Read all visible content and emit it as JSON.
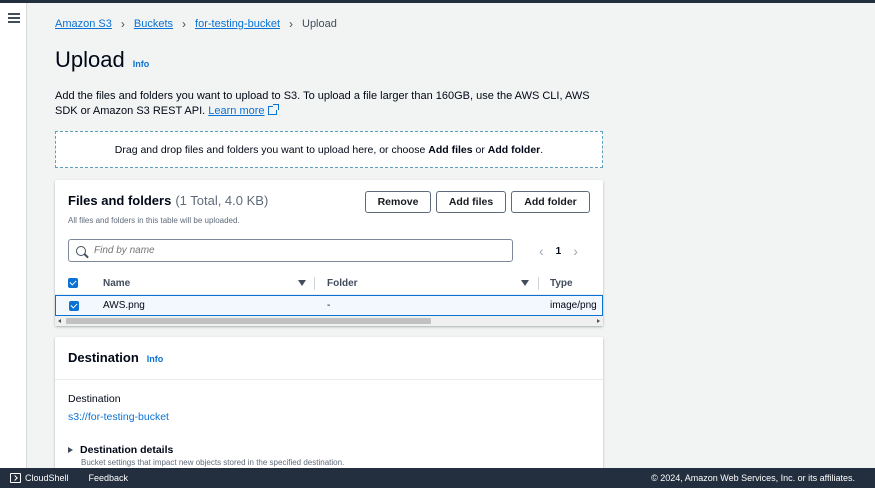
{
  "nav": {
    "menu_icon": "hamburger-icon"
  },
  "breadcrumb": {
    "items": [
      "Amazon S3",
      "Buckets",
      "for-testing-bucket"
    ],
    "current": "Upload",
    "separator_icon": "chevron-right-icon"
  },
  "page": {
    "title": "Upload",
    "info_label": "Info",
    "description": "Add the files and folders you want to upload to S3. To upload a file larger than 160GB, use the AWS CLI, AWS SDK or Amazon S3 REST API.",
    "learn_more": "Learn more",
    "learn_more_icon": "external-link-icon"
  },
  "dropzone": {
    "text_before": "Drag and drop files and folders you want to upload here, or choose ",
    "add_files": "Add files",
    "or": " or ",
    "add_folder": "Add folder",
    "period": "."
  },
  "files_panel": {
    "title": "Files and folders",
    "count": "(1 Total, 4.0 KB)",
    "subtitle": "All files and folders in this table will be uploaded.",
    "buttons": {
      "remove": "Remove",
      "add_files": "Add files",
      "add_folder": "Add folder"
    },
    "search": {
      "placeholder": "Find by name",
      "icon": "search-icon"
    },
    "pagination": {
      "prev": "‹",
      "page": "1",
      "next": "›"
    },
    "columns": [
      "Name",
      "Folder",
      "Type"
    ],
    "rows": [
      {
        "name": "AWS.png",
        "folder": "-",
        "type": "image/png",
        "selected": true
      }
    ]
  },
  "destination_panel": {
    "title": "Destination",
    "info_label": "Info",
    "label": "Destination",
    "value": "s3://for-testing-bucket",
    "details_label": "Destination details",
    "details_sub": "Bucket settings that impact new objects stored in the specified destination."
  },
  "footer": {
    "cloudshell": "CloudShell",
    "feedback": "Feedback",
    "copyright": "© 2024, Amazon Web Services, Inc. or its affiliates."
  },
  "colors": {
    "link": "#0972d3",
    "topbar": "#232f3e",
    "background": "#f2f3f3",
    "selected_row": "#f2f8fd"
  }
}
